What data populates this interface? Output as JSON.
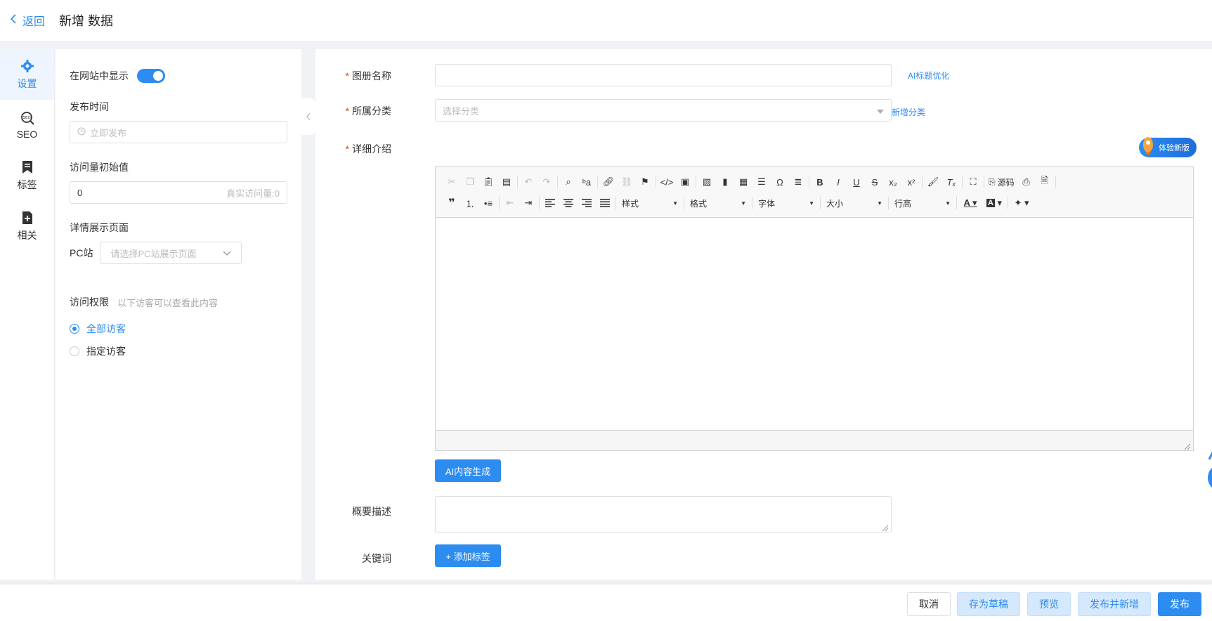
{
  "header": {
    "back_label": "返回",
    "title": "新增 数据"
  },
  "rail": {
    "items": [
      {
        "label": "设置",
        "icon": "gear-icon",
        "active": true
      },
      {
        "label": "SEO",
        "icon": "seo-icon",
        "active": false
      },
      {
        "label": "标签",
        "icon": "bookmark-icon",
        "active": false
      },
      {
        "label": "相关",
        "icon": "file-plus-icon",
        "active": false
      }
    ]
  },
  "settings": {
    "show_on_site_label": "在网站中显示",
    "show_on_site": true,
    "publish_time_label": "发布时间",
    "publish_time_placeholder": "立即发布",
    "initial_views_label": "访问量初始值",
    "initial_views_value": "0",
    "real_views_text": "真实访问量:0",
    "detail_page_label": "详情展示页面",
    "pc_label": "PC站",
    "pc_placeholder": "请选择PC站展示页面",
    "access_label": "访问权限",
    "access_hint": "以下访客可以查看此内容",
    "access_options": [
      {
        "label": "全部访客",
        "checked": true
      },
      {
        "label": "指定访客",
        "checked": false
      }
    ]
  },
  "form": {
    "album_name_label": "图册名称",
    "album_name_value": "",
    "ai_title_link": "AI标题优化",
    "category_label": "所属分类",
    "category_placeholder": "选择分类",
    "new_category_link": "新增分类",
    "detail_label": "详细介绍",
    "try_new_badge": "体验新版",
    "ai_content_button": "AI内容生成",
    "summary_label": "概要描述",
    "summary_value": "",
    "keywords_label": "关键词",
    "add_tag_button": "+ 添加标签"
  },
  "editor": {
    "toolbar_row1_text": {
      "source": "源码"
    },
    "toolbar_row2_combos": [
      "样式",
      "格式",
      "字体",
      "大小",
      "行高"
    ]
  },
  "footer": {
    "cancel": "取消",
    "save_draft": "存为草稿",
    "preview": "预览",
    "publish_and_new": "发布并新增",
    "publish": "发布"
  },
  "colors": {
    "accent": "#2d8cf0",
    "required": "#ed4014"
  }
}
